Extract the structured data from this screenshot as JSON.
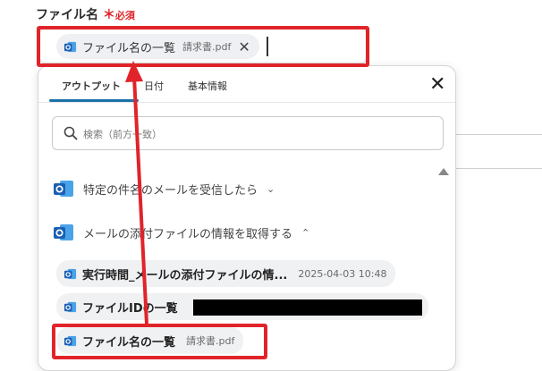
{
  "field": {
    "label": "ファイル名",
    "required_star": "＊",
    "required_text": "必須"
  },
  "input_chip": {
    "name": "ファイル名の一覧",
    "value": "請求書.pdf",
    "remove_glyph": "✕"
  },
  "tabs": [
    {
      "label": "アウトプット",
      "active": true
    },
    {
      "label": "日付",
      "active": false
    },
    {
      "label": "基本情報",
      "active": false
    }
  ],
  "close_glyph": "✕",
  "search": {
    "placeholder": "検索（前方一致）"
  },
  "sections": [
    {
      "label": "特定の件名のメールを受信したら",
      "expanded": false,
      "chevron": "⌄"
    },
    {
      "label": "メールの添付ファイルの情報を取得する",
      "expanded": true,
      "chevron": "⌃"
    }
  ],
  "items": [
    {
      "name": "実行時間_メールの添付ファイルの情...",
      "value": "2025-04-03 10:48"
    },
    {
      "name": "ファイルIDの一覧",
      "value": ""
    },
    {
      "name": "ファイル名の一覧",
      "value": "請求書.pdf"
    }
  ],
  "colors": {
    "accent_red": "#e0242a",
    "outlook_blue": "#1a73c8",
    "tab_underline": "#1a73a8"
  },
  "icons": [
    "outlook-icon",
    "search-icon",
    "close-icon",
    "chevron-down-icon",
    "chevron-up-icon",
    "scroll-up-icon"
  ]
}
